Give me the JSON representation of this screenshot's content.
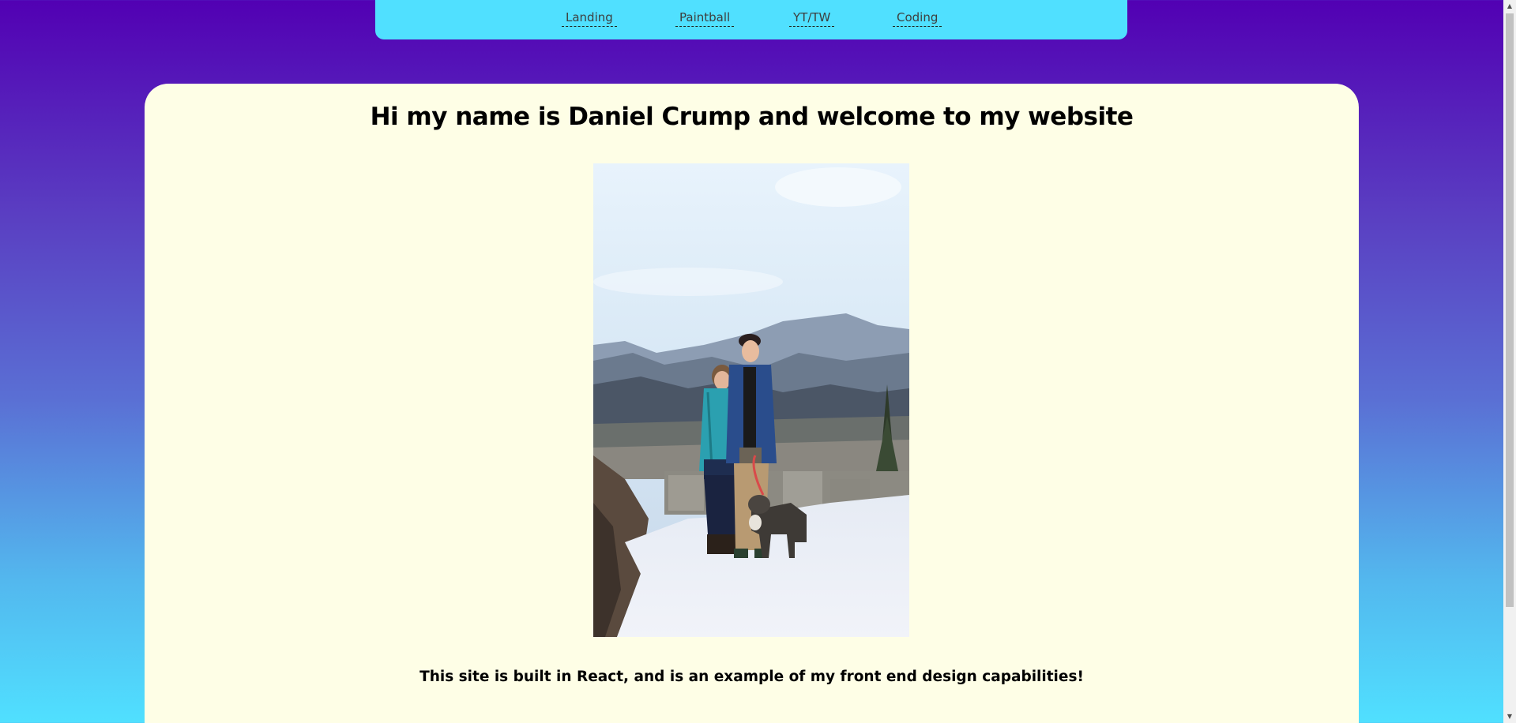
{
  "nav": {
    "items": [
      {
        "label": "Landing"
      },
      {
        "label": "Paintball"
      },
      {
        "label": "YT/TW"
      },
      {
        "label": "Coding"
      }
    ]
  },
  "main": {
    "title": "Hi my name is Daniel Crump and welcome to my website",
    "photo_alt": "",
    "subtitle": "This site is built in React, and is an example of my front end design capabilities!"
  },
  "colors": {
    "nav_background": "#50e0ff",
    "card_background": "#fefee6",
    "gradient_top": "#5200b3",
    "gradient_bottom": "#50e0ff"
  },
  "icons": {
    "scroll_up": "scroll-up-arrow-icon",
    "scroll_down": "scroll-down-arrow-icon"
  }
}
